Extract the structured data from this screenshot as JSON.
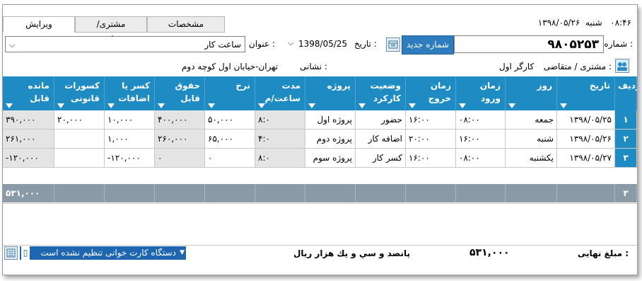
{
  "top": {
    "time": "۰۸:۴۶",
    "day": "شنبه",
    "date": "۱۳۹۸/۰۵/۲۶"
  },
  "tabs": [
    "ویرایش",
    "مشتری/متقاضی",
    "مشخصات"
  ],
  "form": {
    "number_label": "شماره :",
    "number_value": "۹۸۰۵۲۵۳",
    "new_number_button": "شماره جدید",
    "date_label": "تاریخ :",
    "date_value": "1398/05/25",
    "title_label": "عنوان :",
    "title_value": "ساعت کار",
    "customer_label": "مشتری / متقاضی :",
    "customer_value": "کارگر اول",
    "address_label": "نشانی :",
    "address_value": "تهران-خیابان اول کوچه دوم"
  },
  "table": {
    "headers": [
      "ردیف",
      "تاریخ",
      "روز",
      "زمان ورود",
      "زمان خروج",
      "وضعیت کارکرد",
      "پروژه",
      "مدت ساعت/م",
      "نرخ",
      "حقوق قابل",
      "کسر یا اضافات",
      "کسورات قانونی",
      "مانده قابل"
    ],
    "rows": [
      [
        "۱",
        "۱۳۹۸/۰۵/۲۵",
        "جمعه",
        "۰۸:۰۰",
        "۱۶:۰۰",
        "حضور",
        "پروژه اول",
        "۸:۰",
        "۵۰,۰۰۰",
        "۴۰۰,۰۰۰",
        "۱۰,۰۰۰",
        "۲۰,۰۰۰",
        "۳۹۰,۰۰۰"
      ],
      [
        "۲",
        "۱۳۹۸/۰۵/۲۶",
        "شنبه",
        "۱۶:۰۰",
        "۲۰:۰۰",
        "اضافه کار",
        "پروژه دوم",
        "۴:۰",
        "۶۵,۰۰۰",
        "۲۶۰,۰۰۰",
        "۱,۰۰۰",
        "",
        "۲۶۱,۰۰۰"
      ],
      [
        "۳",
        "۱۳۹۸/۰۵/۲۷",
        "یکشنبه",
        "۰۸:۰۰",
        "۱۶:۰۰",
        "کسر کار",
        "پروژه سوم",
        "۸:۰",
        "۰",
        "۰",
        "-۱۲۰,۰۰۰",
        "",
        "-۱۲۰,۰۰۰"
      ]
    ],
    "summary_count": "۳",
    "summary_total": "۵۳۱,۰۰۰"
  },
  "footer": {
    "final_label": "مبلغ نهایی :",
    "final_value": "۵۳۱,۰۰۰",
    "final_words": "پانصد و سي و يك هزار  ريال",
    "card_reader_status": "دستگاه کارت خوانی تنظیم نشده است"
  }
}
